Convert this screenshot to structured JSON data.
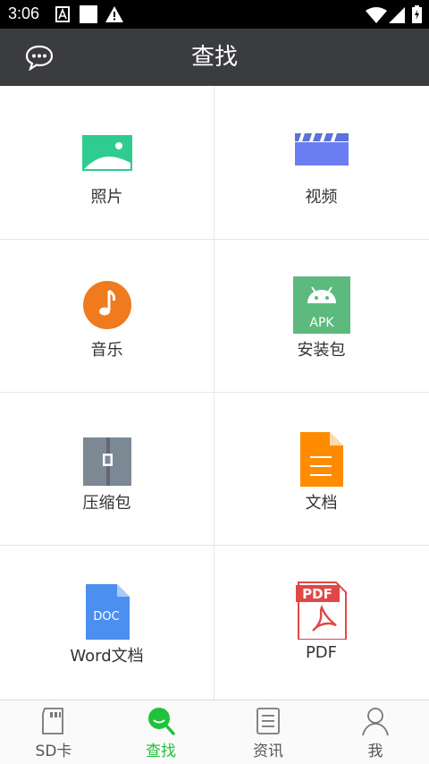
{
  "status_bar": {
    "time": "3:06"
  },
  "app_bar": {
    "title": "查找"
  },
  "categories": [
    {
      "label": "照片",
      "icon": "photo-icon"
    },
    {
      "label": "视频",
      "icon": "video-icon"
    },
    {
      "label": "音乐",
      "icon": "music-icon"
    },
    {
      "label": "安装包",
      "icon": "apk-icon",
      "icon_text": "APK"
    },
    {
      "label": "压缩包",
      "icon": "archive-icon"
    },
    {
      "label": "文档",
      "icon": "document-icon"
    },
    {
      "label": "Word文档",
      "icon": "word-doc-icon",
      "icon_text": "DOC"
    },
    {
      "label": "PDF",
      "icon": "pdf-icon",
      "icon_text": "PDF"
    }
  ],
  "bottom_nav": [
    {
      "label": "SD卡",
      "icon": "sd-card-icon",
      "active": false
    },
    {
      "label": "查找",
      "icon": "search-icon",
      "active": true
    },
    {
      "label": "资讯",
      "icon": "news-icon",
      "active": false
    },
    {
      "label": "我",
      "icon": "profile-icon",
      "active": false
    }
  ],
  "colors": {
    "active_tab": "#20c23b",
    "app_bar": "#3b3c40"
  }
}
